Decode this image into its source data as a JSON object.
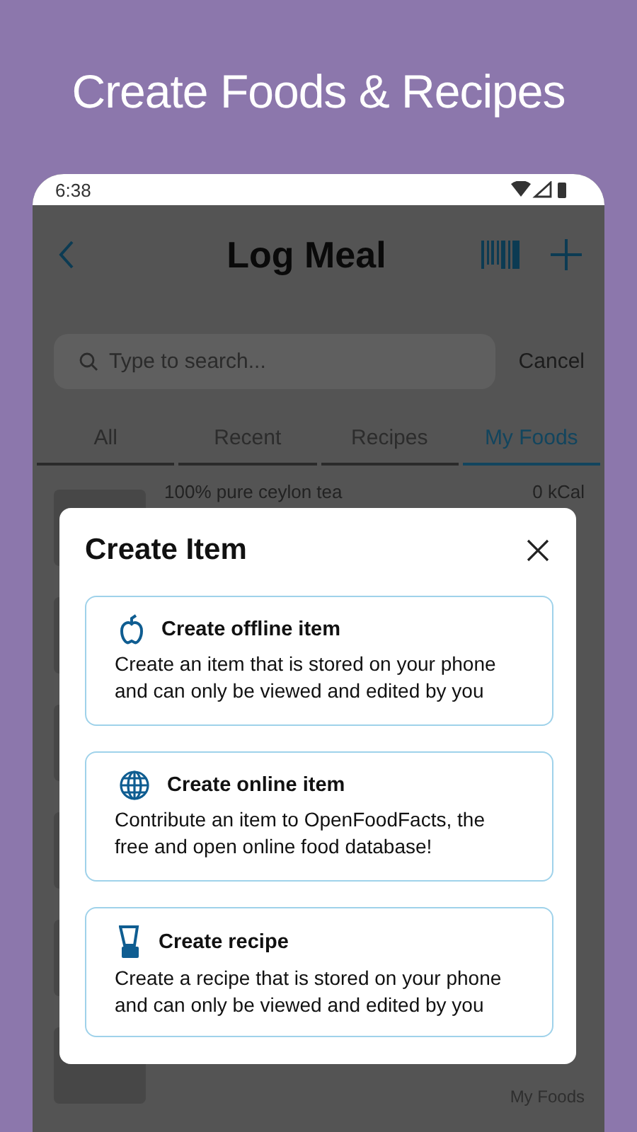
{
  "banner": {
    "title": "Create Foods & Recipes"
  },
  "status_bar": {
    "time": "6:38"
  },
  "app_bar": {
    "title": "Log Meal"
  },
  "search": {
    "placeholder": "Type to search...",
    "cancel": "Cancel"
  },
  "tabs": [
    {
      "label": "All",
      "selected": false
    },
    {
      "label": "Recent",
      "selected": false
    },
    {
      "label": "Recipes",
      "selected": false
    },
    {
      "label": "My Foods",
      "selected": true
    }
  ],
  "food_rows": [
    {
      "name": "100% pure ceylon tea",
      "calories": "0 kCal"
    },
    {},
    {},
    {},
    {},
    {
      "source": "My Foods"
    }
  ],
  "dialog": {
    "title": "Create Item",
    "options": [
      {
        "kind": "offline",
        "title": "Create offline item",
        "description": "Create an item that is stored on your phone and can only be viewed and edited by you"
      },
      {
        "kind": "online",
        "title": "Create online item",
        "description": "Contribute an item to OpenFoodFacts, the free and open online food database!"
      },
      {
        "kind": "recipe",
        "title": "Create recipe",
        "description": "Create a recipe that is stored on your phone and can only be viewed and edited by you"
      }
    ]
  }
}
